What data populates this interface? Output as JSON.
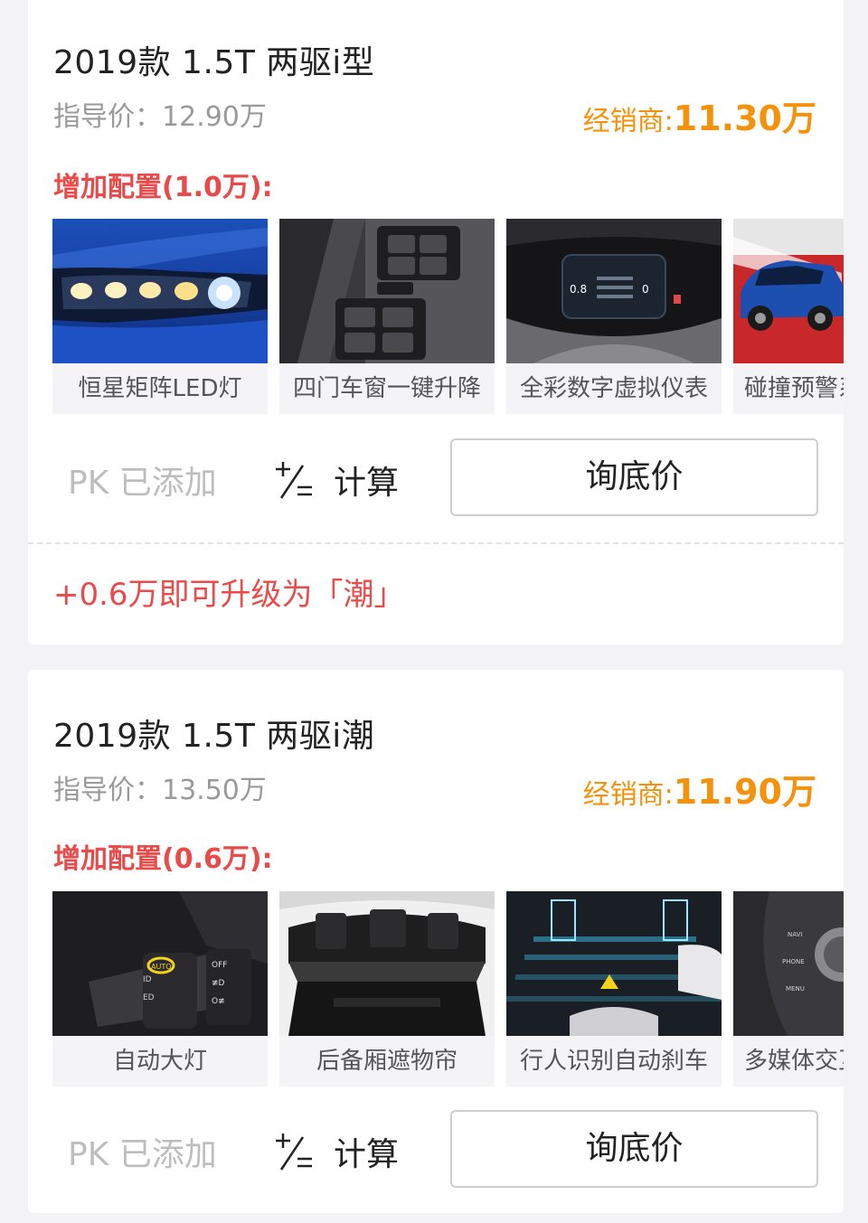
{
  "cards": [
    {
      "title": "2019款 1.5T 两驱i型",
      "guide_price": "指导价：12.90万",
      "dealer_label": "经销商:",
      "dealer_price": "11.30万",
      "config_label": "增加配置(1.0万):",
      "features": [
        {
          "label": "恒星矩阵LED灯",
          "icon": "headlight-image"
        },
        {
          "label": "四门车窗一键升降",
          "icon": "window-switch-image"
        },
        {
          "label": "全彩数字虚拟仪表",
          "icon": "digital-cluster-image"
        },
        {
          "label": "碰撞预警系统",
          "icon": "suv-image"
        }
      ],
      "pk_label": "PK 已添加",
      "calc_label": "计算",
      "ask_label": "询底价",
      "upgrade_text": "+0.6万即可升级为「潮」"
    },
    {
      "title": "2019款 1.5T 两驱i潮",
      "guide_price": "指导价：13.50万",
      "dealer_label": "经销商:",
      "dealer_price": "11.90万",
      "config_label": "增加配置(0.6万):",
      "features": [
        {
          "label": "自动大灯",
          "icon": "light-stalk-image"
        },
        {
          "label": "后备厢遮物帘",
          "icon": "trunk-cover-image"
        },
        {
          "label": "行人识别自动刹车",
          "icon": "pedestrian-detection-image"
        },
        {
          "label": "多媒体交互",
          "icon": "multimedia-knob-image"
        }
      ],
      "pk_label": "PK 已添加",
      "calc_label": "计算",
      "ask_label": "询底价"
    }
  ],
  "colors": {
    "accent_red": "#e94a4a",
    "dealer_orange": "#f5920c",
    "muted_gray": "#9a9a9a"
  }
}
